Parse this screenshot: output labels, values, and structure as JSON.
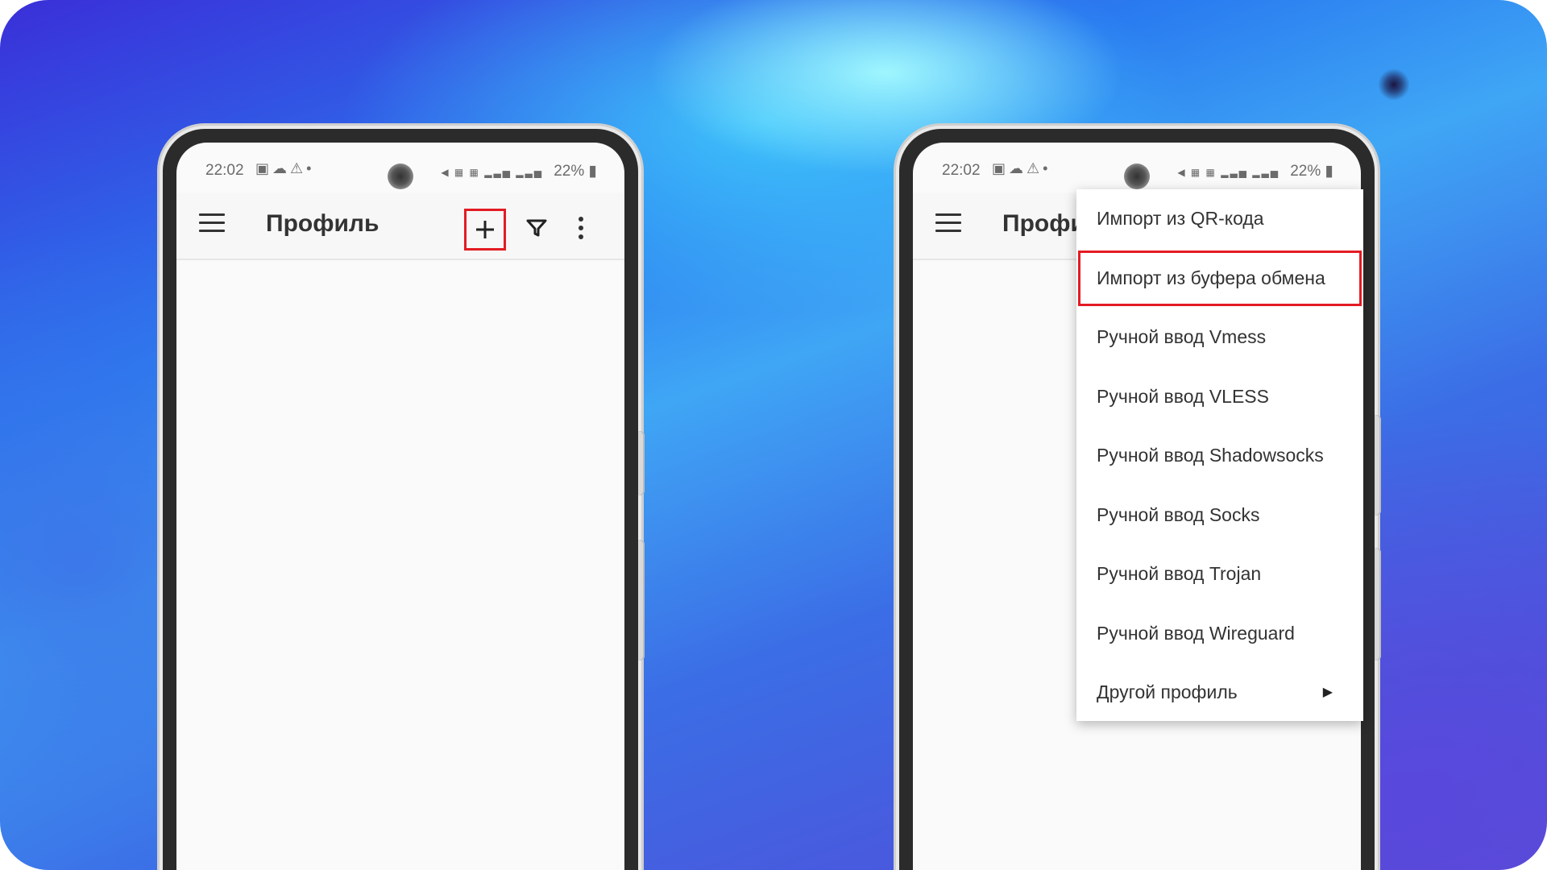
{
  "phones": [
    {
      "status": {
        "time": "22:02",
        "battery": "22%"
      },
      "toolbar": {
        "title": "Профиль"
      }
    },
    {
      "status": {
        "time": "22:02",
        "battery": "22%"
      },
      "toolbar": {
        "title": "Профиль"
      },
      "menu": {
        "items": [
          {
            "label": "Импорт из QR-кода"
          },
          {
            "label": "Импорт из буфера обмена",
            "highlighted": true
          },
          {
            "label": "Ручной ввод Vmess"
          },
          {
            "label": "Ручной ввод VLESS"
          },
          {
            "label": "Ручной ввод Shadowsocks"
          },
          {
            "label": "Ручной ввод Socks"
          },
          {
            "label": "Ручной ввод Trojan"
          },
          {
            "label": "Ручной ввод Wireguard"
          },
          {
            "label": "Другой профиль",
            "submenu": true
          }
        ]
      }
    }
  ],
  "icons": [
    "menu-icon",
    "plus-icon",
    "filter-icon",
    "more-vert-icon",
    "chevron-right-icon",
    "camera-icon"
  ],
  "colors": {
    "highlight": "#e31b23",
    "screen": "#fafafa",
    "frame": "#2b2b2b"
  }
}
